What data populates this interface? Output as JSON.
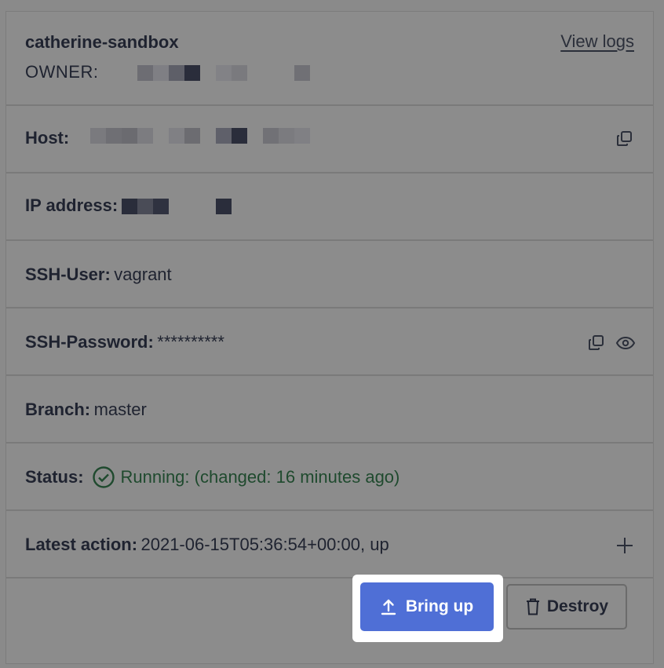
{
  "header": {
    "title": "catherine-sandbox",
    "owner_label": "OWNER:",
    "view_logs": "View logs"
  },
  "rows": {
    "host": {
      "label": "Host:"
    },
    "ip": {
      "label": "IP address:"
    },
    "ssh_user": {
      "label": "SSH-User:",
      "value": "vagrant"
    },
    "ssh_password": {
      "label": "SSH-Password:",
      "value": "**********"
    },
    "branch": {
      "label": "Branch:",
      "value": "master"
    },
    "status": {
      "label": "Status:",
      "value": "Running: (changed: 16 minutes ago)"
    },
    "latest_action": {
      "label": "Latest action:",
      "value": "2021-06-15T05:36:54+00:00, up"
    }
  },
  "actions": {
    "bring_up": "Bring up",
    "destroy": "Destroy"
  },
  "icons": {
    "copy": "copy-icon",
    "eye": "eye-icon",
    "plus": "plus-icon",
    "check": "check-circle-icon",
    "upload": "upload-icon",
    "trash": "trash-icon"
  },
  "colors": {
    "overlay_bg": "#8c8c8c",
    "primary": "#4f6fd6",
    "status_green": "#1f4a2e",
    "text": "#1f2330"
  }
}
